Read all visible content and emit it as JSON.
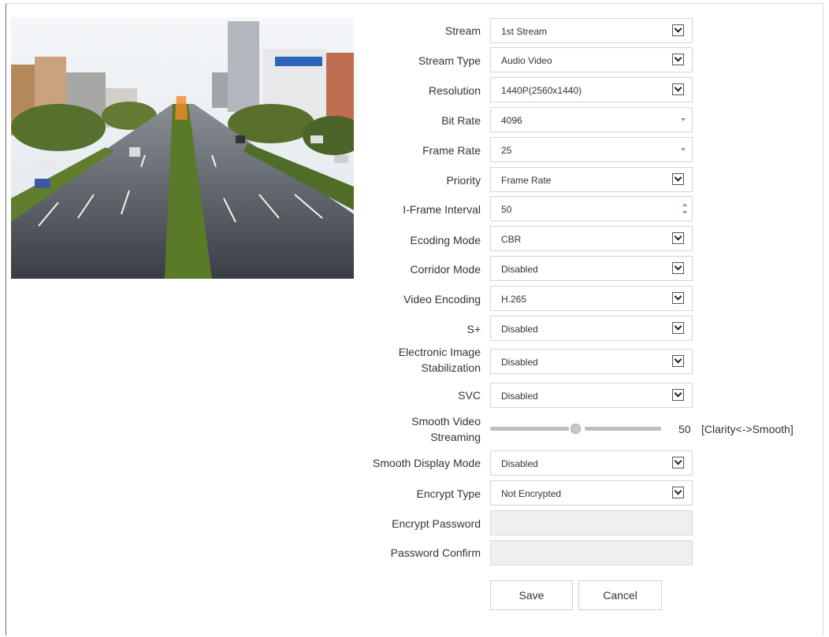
{
  "preview": {
    "alt": "Live video preview: elevated view of a multi-lane city road with buildings"
  },
  "fields": {
    "stream": {
      "label": "Stream",
      "value": "1st Stream"
    },
    "stream_type": {
      "label": "Stream Type",
      "value": "Audio Video"
    },
    "resolution": {
      "label": "Resolution",
      "value": "1440P(2560x1440)"
    },
    "bit_rate": {
      "label": "Bit Rate",
      "value": "4096"
    },
    "frame_rate": {
      "label": "Frame Rate",
      "value": "25"
    },
    "priority": {
      "label": "Priority",
      "value": "Frame Rate"
    },
    "iframe_interval": {
      "label": "I-Frame Interval",
      "value": "50"
    },
    "ecoding_mode": {
      "label": "Ecoding Mode",
      "value": "CBR"
    },
    "corridor_mode": {
      "label": "Corridor Mode",
      "value": "Disabled"
    },
    "video_encoding": {
      "label": "Video Encoding",
      "value": "H.265"
    },
    "s_plus": {
      "label": "S+",
      "value": "Disabled"
    },
    "eis": {
      "label_line1": "Electronic Image",
      "label_line2": "Stabilization",
      "value": "Disabled"
    },
    "svc": {
      "label": "SVC",
      "value": "Disabled"
    },
    "smooth_streaming": {
      "label_line1": "Smooth Video",
      "label_line2": "Streaming",
      "value": "50",
      "hint": "[Clarity<->Smooth]"
    },
    "smooth_display_mode": {
      "label": "Smooth Display Mode",
      "value": "Disabled"
    },
    "encrypt_type": {
      "label": "Encrypt Type",
      "value": "Not Encrypted"
    },
    "encrypt_password": {
      "label": "Encrypt Password",
      "value": ""
    },
    "password_confirm": {
      "label": "Password Confirm",
      "value": ""
    }
  },
  "buttons": {
    "save": "Save",
    "cancel": "Cancel"
  },
  "colors": {
    "spinner_accent": "#5da9d6",
    "disabled_bg": "#efefef"
  }
}
